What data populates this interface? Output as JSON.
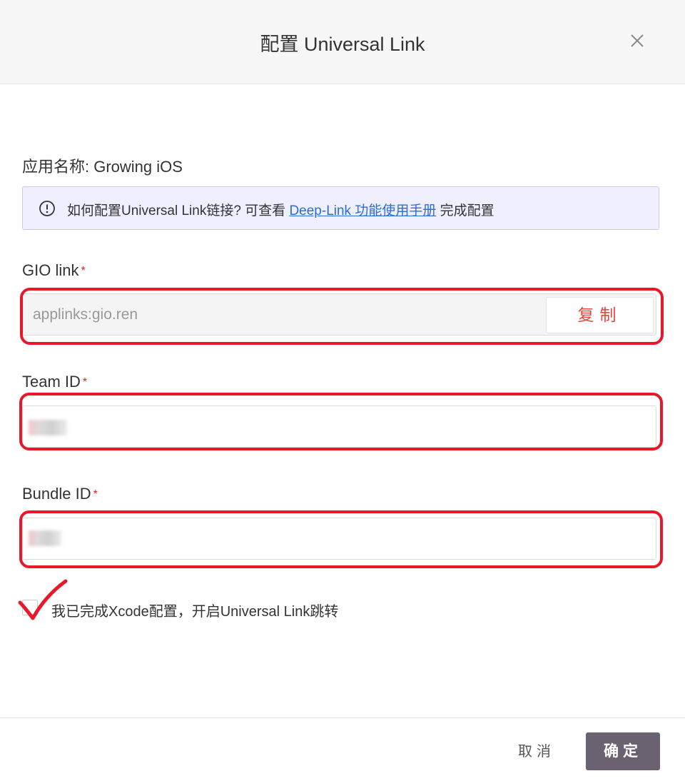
{
  "dialog": {
    "title": "配置 Universal Link",
    "close_icon": "close-icon"
  },
  "app_name": "应用名称: Growing iOS",
  "info": {
    "icon": "info-icon",
    "text_before": "如何配置Universal Link链接? 可查看 ",
    "link_text": "Deep-Link 功能使用手册",
    "text_after": " 完成配置"
  },
  "fields": {
    "gio_link": {
      "label": "GIO link",
      "required_mark": "*",
      "value": "applinks:gio.ren",
      "copy_label": "复制"
    },
    "team_id": {
      "label": "Team ID",
      "required_mark": "*",
      "value": ""
    },
    "bundle_id": {
      "label": "Bundle ID",
      "required_mark": "*",
      "value": ""
    }
  },
  "confirm_checkbox": {
    "label": "我已完成Xcode配置，开启Universal Link跳转",
    "checked": false
  },
  "footer": {
    "cancel_label": "取消",
    "ok_label": "确定"
  },
  "colors": {
    "primary_button": "#6a6270",
    "required": "#e02020",
    "link": "#2b6dd6",
    "copy_text": "#e8453c",
    "annotation": "#e8182a",
    "info_bg": "#f0efff"
  }
}
